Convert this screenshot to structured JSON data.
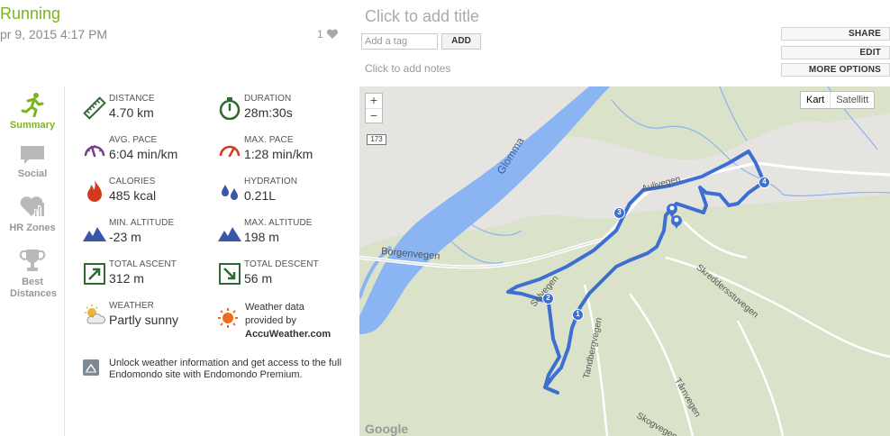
{
  "header": {
    "title": "Running",
    "date": "pr 9, 2015 4:17 PM",
    "likes": "1",
    "add_title": "Click to add title",
    "tag_placeholder": "Add a tag",
    "add_button": "ADD",
    "add_notes": "Click to add notes",
    "actions": [
      "SHARE",
      "EDIT",
      "MORE OPTIONS"
    ]
  },
  "nav": [
    {
      "label": "Summary",
      "icon": "runner-icon",
      "active": true
    },
    {
      "label": "Social",
      "icon": "speech-bubble-icon",
      "active": false
    },
    {
      "label": "HR Zones",
      "icon": "heart-chart-icon",
      "active": false
    },
    {
      "label": "Best Distances",
      "icon": "trophy-icon",
      "active": false
    }
  ],
  "stats": {
    "distance": {
      "label": "DISTANCE",
      "value": "4.70 km",
      "icon": "ruler-icon"
    },
    "duration": {
      "label": "DURATION",
      "value": "28m:30s",
      "icon": "stopwatch-icon"
    },
    "avg_pace": {
      "label": "AVG. PACE",
      "value": "6:04 min/km",
      "icon": "speedometer-icon"
    },
    "max_pace": {
      "label": "MAX. PACE",
      "value": "1:28 min/km",
      "icon": "speedometer-max-icon"
    },
    "calories": {
      "label": "CALORIES",
      "value": "485 kcal",
      "icon": "flame-icon"
    },
    "hydration": {
      "label": "HYDRATION",
      "value": "0.21L",
      "icon": "water-drops-icon"
    },
    "min_altitude": {
      "label": "MIN. ALTITUDE",
      "value": "-23 m",
      "icon": "mountain-icon"
    },
    "max_altitude": {
      "label": "MAX. ALTITUDE",
      "value": "198 m",
      "icon": "mountain-icon"
    },
    "total_ascent": {
      "label": "TOTAL ASCENT",
      "value": "312 m",
      "icon": "arrow-up-right-icon"
    },
    "total_descent": {
      "label": "TOTAL DESCENT",
      "value": "56 m",
      "icon": "arrow-down-right-icon"
    },
    "weather": {
      "label": "WEATHER",
      "value": "Partly sunny",
      "icon": "partly-sunny-icon"
    }
  },
  "weather_note": {
    "line1": "Weather data",
    "line2": "provided by",
    "brand": "AccuWeather.com"
  },
  "unlock_text": "Unlock weather information and get access to the full Endomondo site with Endomondo Premium.",
  "map": {
    "zoom_in": "+",
    "zoom_out": "−",
    "type_map": "Kart",
    "type_satellite": "Satellitt",
    "route_shield": "173",
    "labels": {
      "river": "Glomma",
      "borgenvegen": "Borgenvegen",
      "aulivegen": "Aulivegen",
      "skreddersstuvegen": "Skreddersstuvegen",
      "tandbergvegen": "Tandbergvegen",
      "tarnvegen": "Tårnvegen",
      "skogvegen": "Skogvegen",
      "solvegen": "Solvegen"
    },
    "markers": [
      "1",
      "2",
      "3",
      "4"
    ],
    "attribution": "Google",
    "route_color": "#3d6fd2"
  },
  "colors": {
    "accent": "#7ab51d",
    "icon_green": "#2e6b33",
    "icon_red": "#d23a1e",
    "icon_purple": "#7a3e8a",
    "icon_blue": "#3a57a8"
  }
}
